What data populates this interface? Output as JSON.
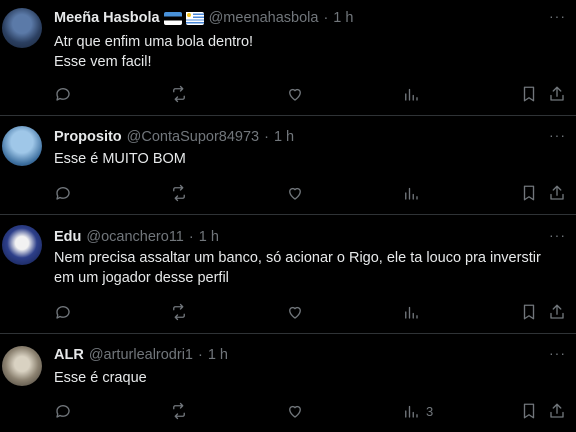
{
  "tweets": [
    {
      "name": "Meeña Hasbola",
      "handle": "@meenahasbola",
      "dot": "·",
      "time": "1 h",
      "flags": [
        "estonia-flag",
        "uruguay-flag"
      ],
      "text": "Atr que enfim uma bola dentro!\nEsse vem facil!",
      "views": ""
    },
    {
      "name": "Proposito",
      "handle": "@ContaSupor84973",
      "dot": "·",
      "time": "1 h",
      "text": "Esse é MUITO BOM",
      "views": ""
    },
    {
      "name": "Edu",
      "handle": "@ocanchero11",
      "dot": "·",
      "time": "1 h",
      "text": "Nem precisa assaltar um banco, só acionar o Rigo, ele ta louco pra inverstir\nem um jogador desse perfil",
      "views": ""
    },
    {
      "name": "ALR",
      "handle": "@arturlealrodri1",
      "dot": "·",
      "time": "1 h",
      "text": "Esse é craque",
      "views": "3"
    }
  ],
  "more_label": "···",
  "icons": [
    "reply-icon",
    "retweet-icon",
    "like-icon",
    "views-icon",
    "bookmark-icon",
    "share-icon"
  ]
}
